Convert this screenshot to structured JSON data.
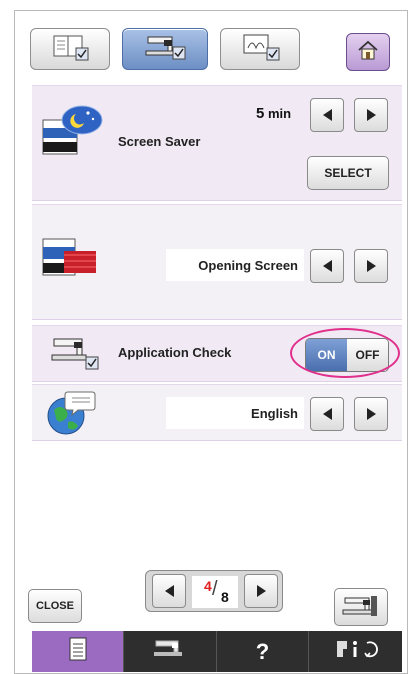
{
  "tabs": [
    {
      "name": "general-settings",
      "active": false
    },
    {
      "name": "machine-settings",
      "active": true
    },
    {
      "name": "screen-settings",
      "active": false
    }
  ],
  "screen_saver": {
    "label": "Screen Saver",
    "value_number": "5",
    "value_unit": "min",
    "select_label": "SELECT"
  },
  "opening_screen": {
    "label": "Opening Screen"
  },
  "application_check": {
    "label": "Application Check",
    "on_label": "ON",
    "off_label": "OFF",
    "state": "on"
  },
  "language": {
    "value": "English"
  },
  "footer": {
    "close_label": "CLOSE",
    "page_current": "4",
    "page_total": "8",
    "help_label": "?"
  },
  "colors": {
    "accent_purple": "#9a6bc0",
    "page_current": "#e02020",
    "highlight_ring": "#e0308c"
  }
}
